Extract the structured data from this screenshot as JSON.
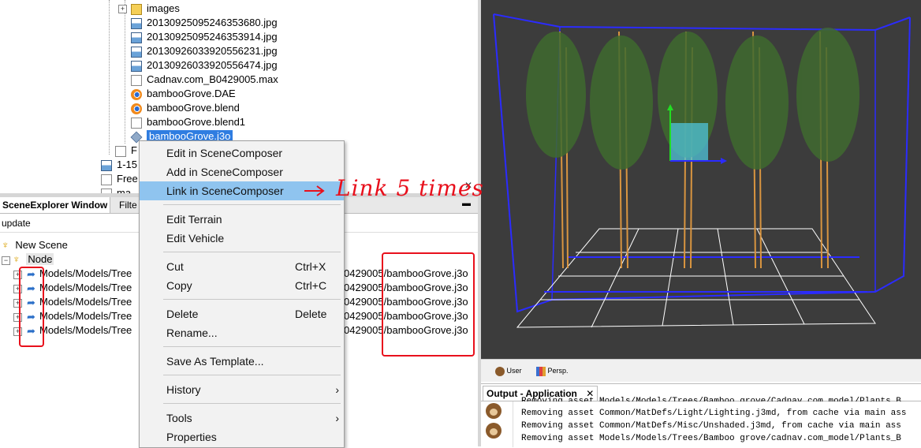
{
  "file_tree": {
    "items": [
      {
        "label": "images",
        "icon": "folder-icon"
      },
      {
        "label": "20130925095246353680.jpg",
        "icon": "image-file-icon"
      },
      {
        "label": "20130925095246353914.jpg",
        "icon": "image-file-icon"
      },
      {
        "label": "20130926033920556231.jpg",
        "icon": "image-file-icon"
      },
      {
        "label": "20130926033920556474.jpg",
        "icon": "image-file-icon"
      },
      {
        "label": "Cadnav.com_B0429005.max",
        "icon": "file-icon"
      },
      {
        "label": "bambooGrove.DAE",
        "icon": "blender-icon"
      },
      {
        "label": "bambooGrove.blend",
        "icon": "blender-icon"
      },
      {
        "label": "bambooGrove.blend1",
        "icon": "file-icon"
      },
      {
        "label": "bambooGrove.j3o",
        "icon": "j3o-model-icon"
      }
    ],
    "partial": [
      "F",
      "1-15",
      "Free",
      "ma"
    ]
  },
  "scene_explorer": {
    "tabs": [
      "SceneExplorer Window",
      "Filte"
    ],
    "update_label": "update",
    "root": "New Scene",
    "node": "Node",
    "children": [
      {
        "left": "Models/Models/Tree",
        "mid": "0429005",
        "right": "/bambooGrove.j3o"
      },
      {
        "left": "Models/Models/Tree",
        "mid": "0429005",
        "right": "/bambooGrove.j3o"
      },
      {
        "left": "Models/Models/Tree",
        "mid": "0429005",
        "right": "/bambooGrove.j3o"
      },
      {
        "left": "Models/Models/Tree",
        "mid": "0429005",
        "right": "/bambooGrove.j3o"
      },
      {
        "left": "Models/Models/Tree",
        "mid": "0429005",
        "right": "/bambooGrove.j3o"
      }
    ]
  },
  "context_menu": {
    "edit_in": "Edit in SceneComposer",
    "add_in": "Add in SceneComposer",
    "link_in": "Link in SceneComposer",
    "edit_terrain": "Edit Terrain",
    "edit_vehicle": "Edit Vehicle",
    "cut": "Cut",
    "cut_sc": "Ctrl+X",
    "copy": "Copy",
    "copy_sc": "Ctrl+C",
    "delete": "Delete",
    "delete_sc": "Delete",
    "rename": "Rename...",
    "save_template": "Save As Template...",
    "history": "History",
    "tools": "Tools",
    "properties": "Properties"
  },
  "annotation": {
    "text": "Link 5 times",
    "color": "#e8101c"
  },
  "viewport": {
    "buttons": [
      {
        "label": "User",
        "icon": "camera-user-icon"
      },
      {
        "label": "Persp.",
        "icon": "perspective-icon"
      }
    ],
    "bg": "#3c3c3c"
  },
  "output": {
    "tab": "Output - Application",
    "lines": [
      "Removing asset Models/Models/Trees/Bamboo grove/Cadnav.com_model/Plants_B",
      "Removing asset Common/MatDefs/Light/Lighting.j3md, from cache via main ass",
      "Removing asset Common/MatDefs/Misc/Unshaded.j3md, from cache via main ass",
      "Removing asset Models/Models/Trees/Bamboo grove/cadnav.com_model/Plants_B"
    ]
  },
  "colors": {
    "selection": "#2f7de1",
    "menu_highlight": "#8fc4ef",
    "annotation": "#e8101c"
  }
}
